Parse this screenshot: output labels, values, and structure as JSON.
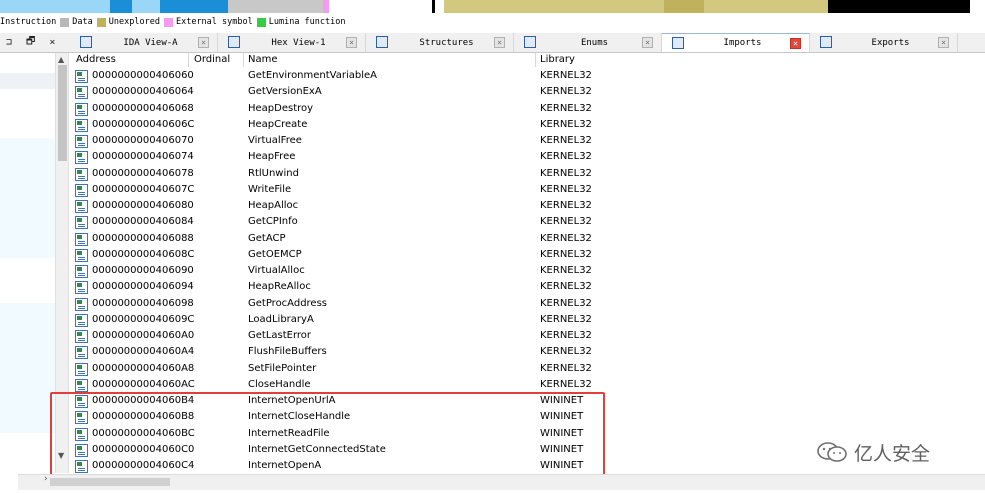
{
  "legend": [
    {
      "label": "Instruction",
      "color": "#ffffff"
    },
    {
      "label": "Data",
      "color": "#b8b8b8"
    },
    {
      "label": "Unexplored",
      "color": "#c0b25c"
    },
    {
      "label": "External symbol",
      "color": "#f59cf2"
    },
    {
      "label": "Lumina function",
      "color": "#33cc44"
    }
  ],
  "nav_colors": {
    "code": "#9ad6f5",
    "data": "#1a8fd8",
    "unexplored": "#d2c880",
    "external": "#000000"
  },
  "tabs": [
    {
      "label": "IDA View-A",
      "icon": "ida-view-icon",
      "active": false
    },
    {
      "label": "Hex View-1",
      "icon": "hex-view-icon",
      "active": false
    },
    {
      "label": "Structures",
      "icon": "structures-icon",
      "active": false
    },
    {
      "label": "Enums",
      "icon": "enums-icon",
      "active": false
    },
    {
      "label": "Imports",
      "icon": "imports-icon",
      "active": true
    },
    {
      "label": "Exports",
      "icon": "exports-icon",
      "active": false
    }
  ],
  "left_controls": [
    "⊐",
    "🗗",
    "×"
  ],
  "columns": {
    "address": "Address",
    "ordinal": "Ordinal",
    "name": "Name",
    "library": "Library"
  },
  "rows": [
    {
      "address": "0000000000406060",
      "name": "GetEnvironmentVariableA",
      "library": "KERNEL32"
    },
    {
      "address": "0000000000406064",
      "name": "GetVersionExA",
      "library": "KERNEL32"
    },
    {
      "address": "0000000000406068",
      "name": "HeapDestroy",
      "library": "KERNEL32"
    },
    {
      "address": "000000000040606C",
      "name": "HeapCreate",
      "library": "KERNEL32"
    },
    {
      "address": "0000000000406070",
      "name": "VirtualFree",
      "library": "KERNEL32"
    },
    {
      "address": "0000000000406074",
      "name": "HeapFree",
      "library": "KERNEL32"
    },
    {
      "address": "0000000000406078",
      "name": "RtlUnwind",
      "library": "KERNEL32"
    },
    {
      "address": "000000000040607C",
      "name": "WriteFile",
      "library": "KERNEL32"
    },
    {
      "address": "0000000000406080",
      "name": "HeapAlloc",
      "library": "KERNEL32"
    },
    {
      "address": "0000000000406084",
      "name": "GetCPInfo",
      "library": "KERNEL32"
    },
    {
      "address": "0000000000406088",
      "name": "GetACP",
      "library": "KERNEL32"
    },
    {
      "address": "000000000040608C",
      "name": "GetOEMCP",
      "library": "KERNEL32"
    },
    {
      "address": "0000000000406090",
      "name": "VirtualAlloc",
      "library": "KERNEL32"
    },
    {
      "address": "0000000000406094",
      "name": "HeapReAlloc",
      "library": "KERNEL32"
    },
    {
      "address": "0000000000406098",
      "name": "GetProcAddress",
      "library": "KERNEL32"
    },
    {
      "address": "000000000040609C",
      "name": "LoadLibraryA",
      "library": "KERNEL32"
    },
    {
      "address": "00000000004060A0",
      "name": "GetLastError",
      "library": "KERNEL32"
    },
    {
      "address": "00000000004060A4",
      "name": "FlushFileBuffers",
      "library": "KERNEL32"
    },
    {
      "address": "00000000004060A8",
      "name": "SetFilePointer",
      "library": "KERNEL32"
    },
    {
      "address": "00000000004060AC",
      "name": "CloseHandle",
      "library": "KERNEL32"
    },
    {
      "address": "00000000004060B4",
      "name": "InternetOpenUrlA",
      "library": "WININET"
    },
    {
      "address": "00000000004060B8",
      "name": "InternetCloseHandle",
      "library": "WININET"
    },
    {
      "address": "00000000004060BC",
      "name": "InternetReadFile",
      "library": "WININET"
    },
    {
      "address": "00000000004060C0",
      "name": "InternetGetConnectedState",
      "library": "WININET"
    },
    {
      "address": "00000000004060C4",
      "name": "InternetOpenA",
      "library": "WININET"
    }
  ],
  "watermark": {
    "text": "亿人安全",
    "icon": "wechat-icon"
  },
  "highlight_color": "#e0403a"
}
